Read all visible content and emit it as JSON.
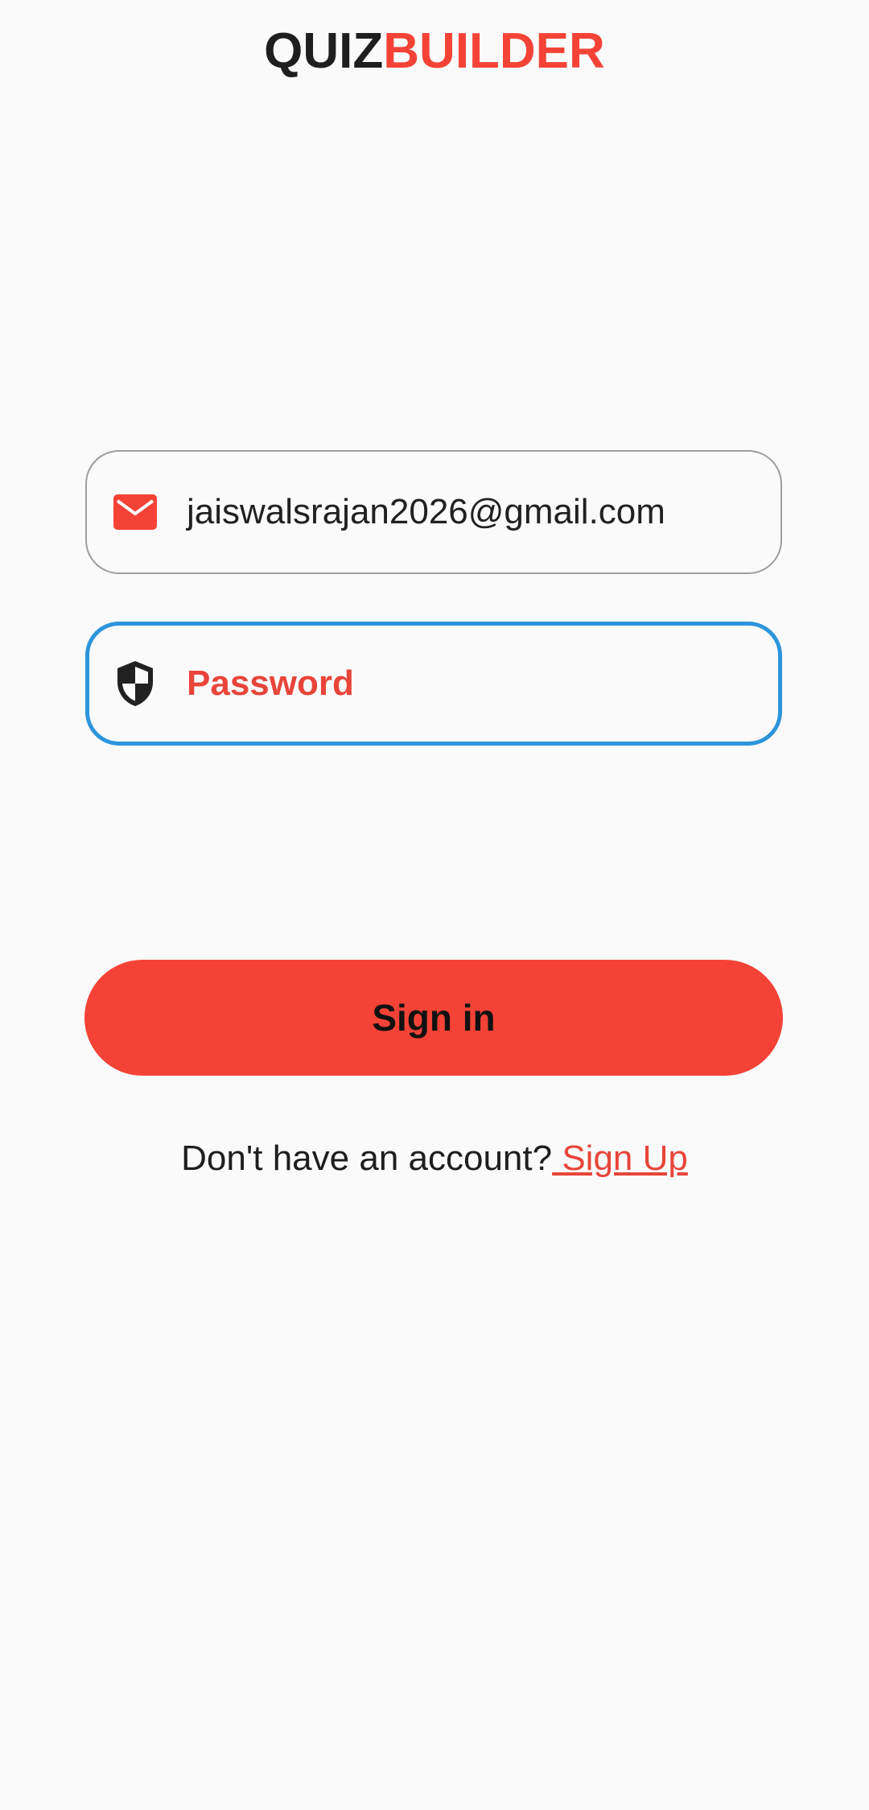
{
  "app": {
    "logo_part1": "QUIZ",
    "logo_part2": "BUILDER"
  },
  "form": {
    "email": {
      "value": "jaiswalsrajan2026@gmail.com",
      "icon": "mail-icon"
    },
    "password": {
      "placeholder": "Password",
      "icon": "shield-icon",
      "focused": true
    },
    "signin_label": "Sign in",
    "signup_prompt": "Don't have an account?",
    "signup_link": " Sign Up"
  },
  "colors": {
    "brand_red": "#f44336",
    "focus_blue": "#2d95dc",
    "text_dark": "#1e1e1e"
  }
}
